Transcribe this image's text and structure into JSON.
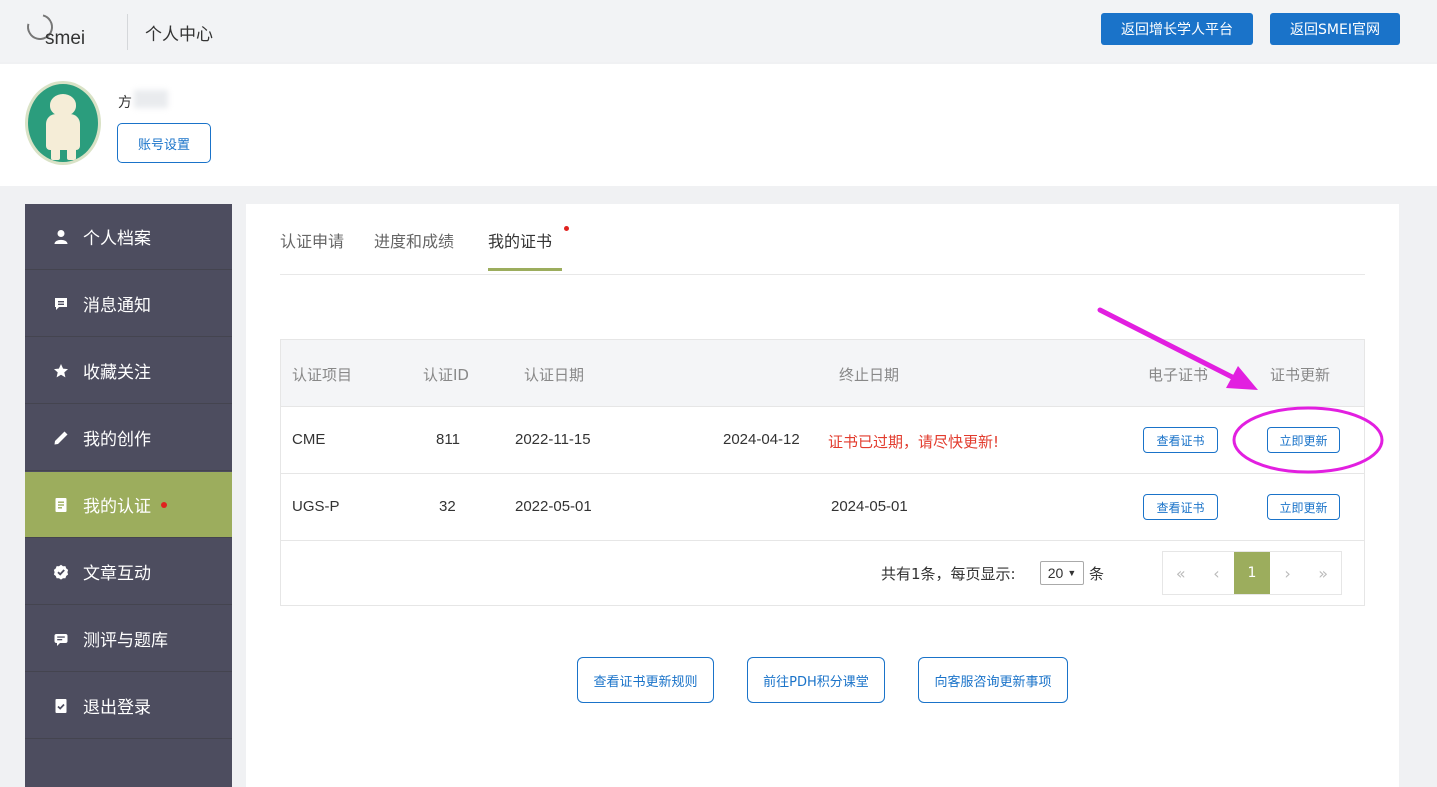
{
  "header": {
    "logo_text": "smei",
    "title": "个人中心",
    "btn_growth": "返回增长学人平台",
    "btn_official": "返回SMEI官网"
  },
  "profile": {
    "name": "方",
    "account_settings": "账号设置"
  },
  "sidebar": {
    "items": [
      {
        "label": "个人档案",
        "icon": "user-icon"
      },
      {
        "label": "消息通知",
        "icon": "message-icon"
      },
      {
        "label": "收藏关注",
        "icon": "star-icon"
      },
      {
        "label": "我的创作",
        "icon": "pencil-icon"
      },
      {
        "label": "我的认证",
        "icon": "certificate-icon",
        "active": true
      },
      {
        "label": "文章互动",
        "icon": "badge-check-icon"
      },
      {
        "label": "测评与题库",
        "icon": "quiz-icon"
      },
      {
        "label": "退出登录",
        "icon": "logout-icon"
      }
    ]
  },
  "tabs": [
    "认证申请",
    "进度和成绩",
    "我的证书"
  ],
  "table": {
    "headers": [
      "认证项目",
      "认证ID",
      "认证日期",
      "终止日期",
      "电子证书",
      "证书更新"
    ],
    "rows": [
      {
        "project": "CME",
        "id": "811",
        "start": "2022-11-15",
        "end": "2024-04-12",
        "warning": "证书已过期，请尽快更新!",
        "view": "查看证书",
        "renew": "立即更新"
      },
      {
        "project": "UGS-P",
        "id": "32",
        "start": "2022-05-01",
        "end": "2024-05-01",
        "warning": "",
        "view": "查看证书",
        "renew": "立即更新"
      }
    ]
  },
  "pagination": {
    "summary": "共有1条，每页显示:",
    "page_size": "20",
    "unit": "条",
    "first": "«",
    "prev": "‹",
    "current": "1",
    "next": "›",
    "last": "»"
  },
  "actions": {
    "rules": "查看证书更新规则",
    "pdh": "前往PDH积分课堂",
    "consult": "向客服咨询更新事项"
  },
  "colors": {
    "primary": "#1a73c9",
    "accent": "#9cad5d",
    "sidebar": "#4d4d5f",
    "warning": "#e23b2d",
    "annotation": "#e21fe0"
  }
}
